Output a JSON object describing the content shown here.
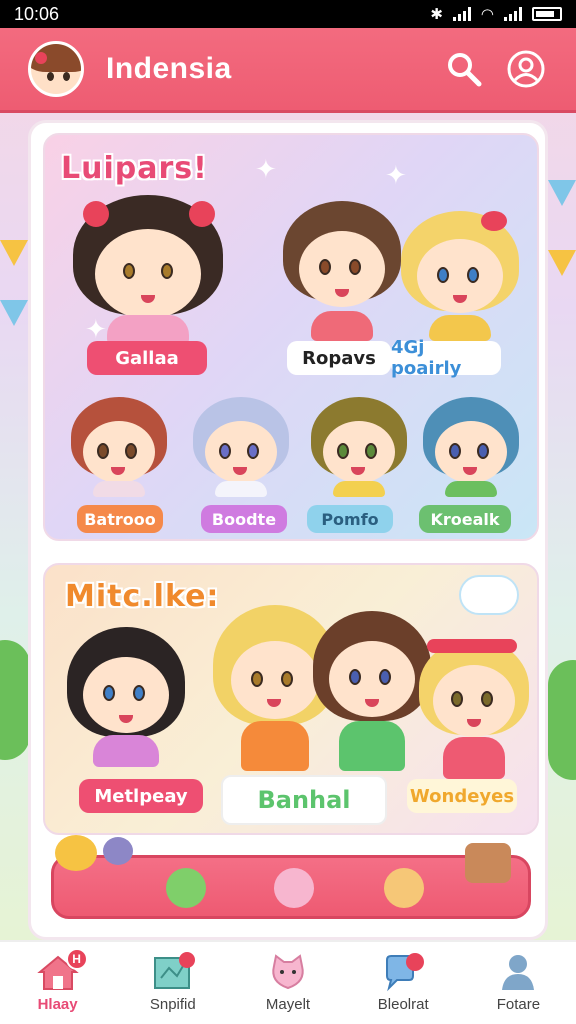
{
  "status_bar": {
    "time": "10:06"
  },
  "header": {
    "title": "Indensia"
  },
  "panel1": {
    "title": "Luipars!",
    "labels": [
      "Gallaa",
      "Ropavs",
      "4Gj poairly",
      "Batrooo",
      "Boodte",
      "Pomfo",
      "Kroealk"
    ]
  },
  "panel2": {
    "title": "Mitc.lke:",
    "labels": [
      "Metlpeay",
      "Banhal",
      "Wondeyes"
    ]
  },
  "bottom_nav": [
    {
      "label": "Hlaay",
      "badge": "H",
      "active": true
    },
    {
      "label": "Snpifid",
      "badge": "",
      "active": false
    },
    {
      "label": "Mayelt",
      "badge": "",
      "active": false
    },
    {
      "label": "Bleolrat",
      "badge": "",
      "active": false
    },
    {
      "label": "Fotare",
      "badge": "",
      "active": false
    }
  ],
  "colors": {
    "brand": "#ef5f75",
    "accent_orange": "#f08a2d",
    "accent_green": "#5cc46d"
  }
}
